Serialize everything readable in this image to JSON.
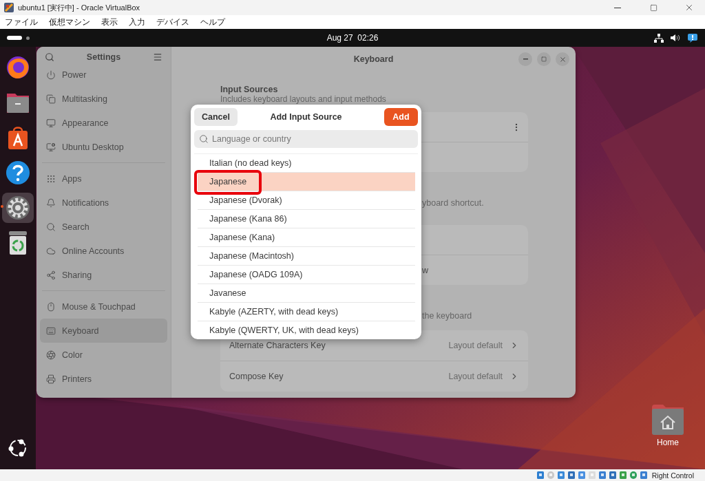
{
  "window": {
    "title": "ubuntu1 [実行中] - Oracle VirtualBox"
  },
  "menu": [
    "ファイル",
    "仮想マシン",
    "表示",
    "入力",
    "デバイス",
    "ヘルプ"
  ],
  "top_bar": {
    "clock": "Aug 27  02:26"
  },
  "dock": [
    {
      "kind": "browser",
      "selected": false
    },
    {
      "kind": "files",
      "selected": false
    },
    {
      "kind": "store",
      "selected": false
    },
    {
      "kind": "help",
      "selected": false
    },
    {
      "kind": "settings",
      "selected": true
    },
    {
      "kind": "trash",
      "selected": false
    }
  ],
  "settings": {
    "sidebar_title": "Settings",
    "page_title": "Keyboard",
    "sidebar": [
      [
        {
          "kind": "power",
          "label": "Power",
          "selected": false
        },
        {
          "kind": "multitasking",
          "label": "Multitasking",
          "selected": false
        },
        {
          "kind": "appearance",
          "label": "Appearance",
          "selected": false
        },
        {
          "kind": "desktop",
          "label": "Ubuntu Desktop",
          "selected": false
        }
      ],
      [
        {
          "kind": "apps",
          "label": "Apps",
          "selected": false
        },
        {
          "kind": "notifications",
          "label": "Notifications",
          "selected": false
        },
        {
          "kind": "search",
          "label": "Search",
          "selected": false
        },
        {
          "kind": "accounts",
          "label": "Online Accounts",
          "selected": false
        },
        {
          "kind": "sharing",
          "label": "Sharing",
          "selected": false
        }
      ],
      [
        {
          "kind": "mouse",
          "label": "Mouse & Touchpad",
          "selected": false
        },
        {
          "kind": "keyboard",
          "label": "Keyboard",
          "selected": true
        },
        {
          "kind": "color",
          "label": "Color",
          "selected": false
        },
        {
          "kind": "printers",
          "label": "Printers",
          "selected": false
        }
      ]
    ],
    "content": {
      "section_title": "Input Sources",
      "section_subtitle": "Includes keyboard layouts and input methods",
      "shortcut_hint": "yboard shortcut.",
      "switch_row": "w",
      "special_caption": "the keyboard",
      "rows": [
        {
          "label": "Alternate Characters Key",
          "value": "Layout default"
        },
        {
          "label": "Compose Key",
          "value": "Layout default"
        }
      ]
    }
  },
  "dialog": {
    "title": "Add Input Source",
    "cancel": "Cancel",
    "add": "Add",
    "search": {
      "placeholder": "Language or country"
    },
    "items": [
      {
        "label": "Italian (no dead keys)",
        "selected": false,
        "highlighted": false
      },
      {
        "label": "Japanese",
        "selected": true,
        "highlighted": true
      },
      {
        "label": "Japanese (Dvorak)",
        "selected": false,
        "highlighted": false
      },
      {
        "label": "Japanese (Kana 86)",
        "selected": false,
        "highlighted": false
      },
      {
        "label": "Japanese (Kana)",
        "selected": false,
        "highlighted": false
      },
      {
        "label": "Japanese (Macintosh)",
        "selected": false,
        "highlighted": false
      },
      {
        "label": "Japanese (OADG 109A)",
        "selected": false,
        "highlighted": false
      },
      {
        "label": "Javanese",
        "selected": false,
        "highlighted": false
      },
      {
        "label": "Kabyle (AZERTY, with dead keys)",
        "selected": false,
        "highlighted": false
      },
      {
        "label": "Kabyle (QWERTY, UK, with dead keys)",
        "selected": false,
        "highlighted": false
      }
    ]
  },
  "desktop_icons": [
    {
      "label": "Home"
    }
  ],
  "status_bar": {
    "host_key": "Right Control"
  }
}
